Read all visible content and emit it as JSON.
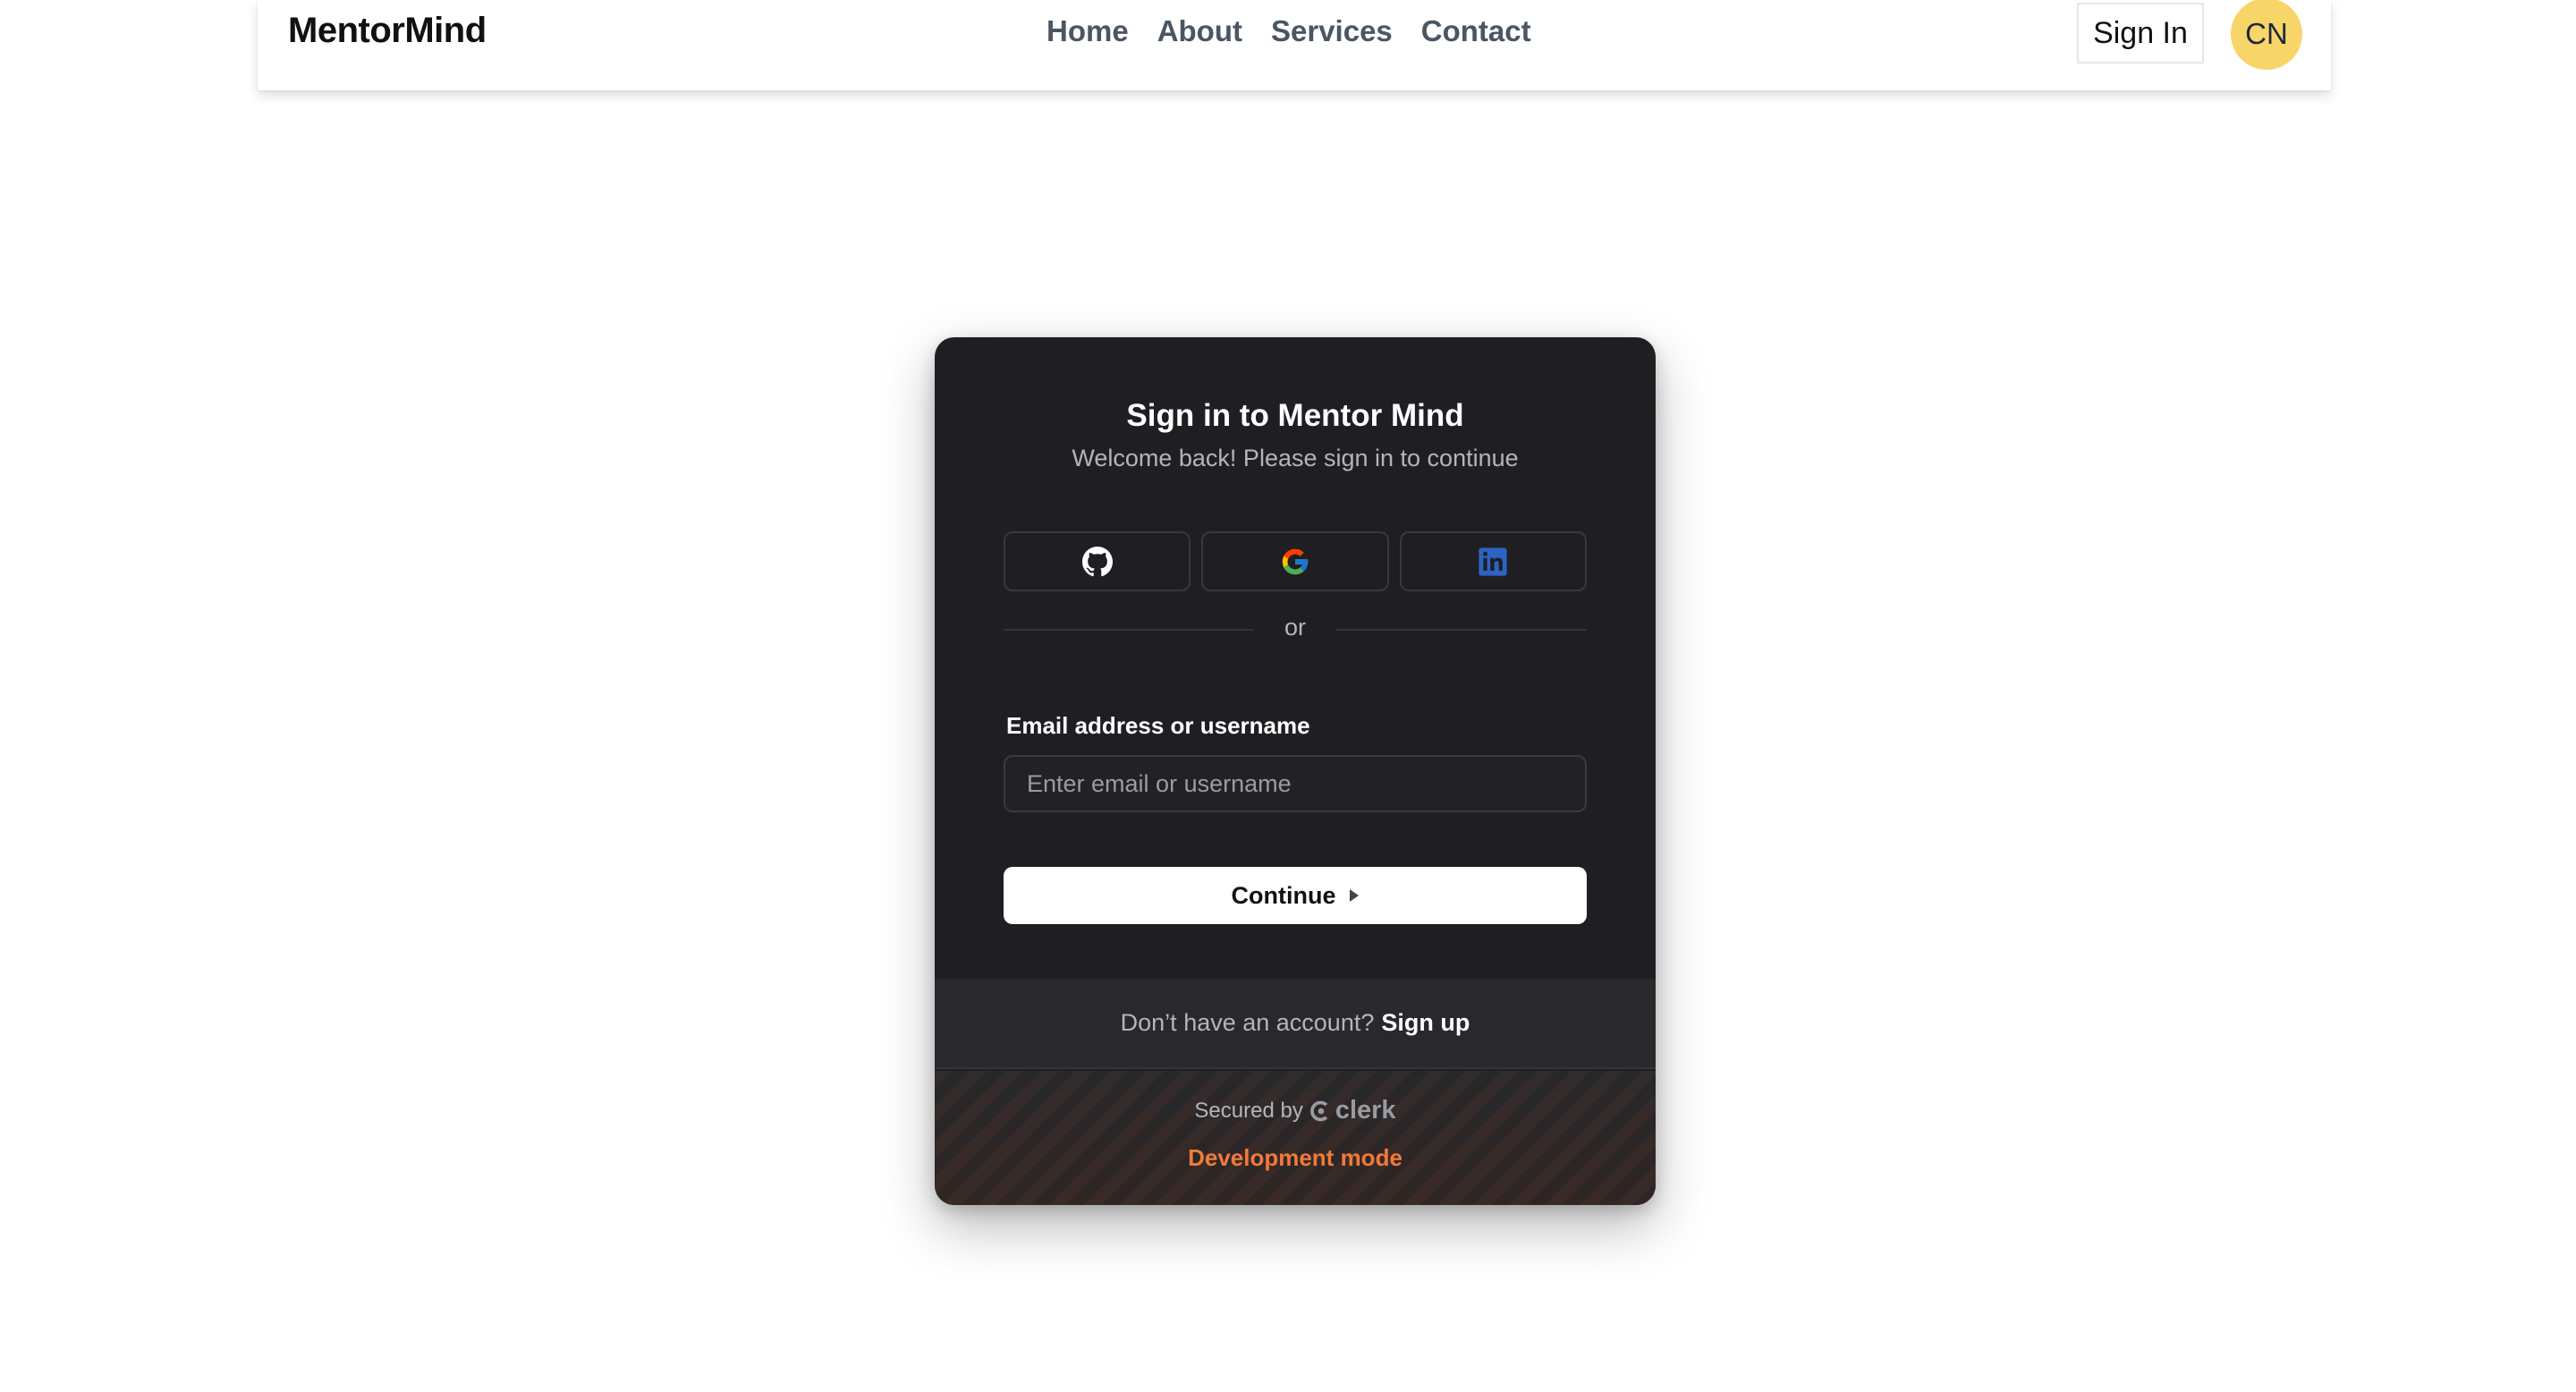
{
  "header": {
    "brand": "MentorMind",
    "nav": [
      "Home",
      "About",
      "Services",
      "Contact"
    ],
    "sign_in_label": "Sign In",
    "avatar_initials": "CN",
    "avatar_color": "#f7d569"
  },
  "signin_card": {
    "title": "Sign in to Mentor Mind",
    "subtitle": "Welcome back! Please sign in to continue",
    "social_providers": [
      {
        "name": "GitHub",
        "icon": "github-icon"
      },
      {
        "name": "Google",
        "icon": "google-icon"
      },
      {
        "name": "LinkedIn",
        "icon": "linkedin-icon"
      }
    ],
    "divider_text": "or",
    "email_label": "Email address or username",
    "email_placeholder": "Enter email or username",
    "email_value": "",
    "continue_label": "Continue",
    "no_account_text": "Don’t have an account?",
    "sign_up_label": "Sign up",
    "secured_by": "Secured by",
    "clerk_brand": "clerk",
    "dev_mode": "Development mode",
    "dev_mode_color": "#f07a3a",
    "card_background": "#1f1f23"
  }
}
